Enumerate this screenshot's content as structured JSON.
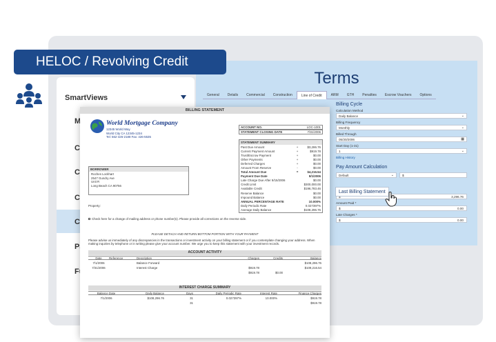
{
  "banner": {
    "title": "HELOC / Revolving Credit"
  },
  "sidebar": {
    "title": "SmartViews",
    "items": [
      {
        "label": "Ma"
      },
      {
        "label": "Ca"
      },
      {
        "label": "CA"
      },
      {
        "label": "CA"
      },
      {
        "label": "CA"
      },
      {
        "label": "Pa"
      },
      {
        "label": "Fu"
      }
    ]
  },
  "terms": {
    "title": "Terms",
    "tabs": [
      "General",
      "Details",
      "Commercial",
      "Construction",
      "Line of Credit",
      "ARM",
      "GTH",
      "Penalties",
      "Escrow Vouchers",
      "Options"
    ],
    "active_tab": "Line of Credit",
    "billing_cycle": {
      "heading": "Billing Cycle",
      "calc_method_label": "Calculation Method",
      "calc_method_value": "Daily Balance",
      "frequency_label": "Billing Frequency",
      "frequency_value": "Monthly",
      "billed_through_label": "Billed Through",
      "billed_through_value": "05/30/2006",
      "start_day_label": "Start Day (1-31)",
      "start_day_value": "1",
      "history_link": "Billing History"
    },
    "payment": {
      "heading": "Pay Amount Calculation",
      "method_value": "Default",
      "currency": "$",
      "last_statement_label": "Last Billing Statement",
      "amount_billed_label": "Amount Billed *",
      "amount_billed_value": "3,296.76",
      "amount_paid_label": "Amount Paid *",
      "amount_paid_value": "0.00",
      "late_charges_label": "Late Charges *",
      "late_charges_value": "0.00"
    }
  },
  "statement": {
    "title": "BILLING STATEMENT",
    "company": "World Mortgage Company",
    "company_addr": [
      "12345 World Way",
      "World City CA 12345-1234",
      "Tel: 562-426-2188  Fax: 426-5535"
    ],
    "account_rows": [
      {
        "k": "ACCOUNT NO.",
        "v": "LOC-1001"
      },
      {
        "k": "STATEMENT CLOSING DATE",
        "v": "7/31/2006"
      }
    ],
    "summary_title": "STATEMENT SUMMARY",
    "summary_rows": [
      {
        "k": "Past Due Amount",
        "e": "+",
        "v": "$3,286.76"
      },
      {
        "k": "Current Payment Amount",
        "e": "+",
        "v": "$919.78"
      },
      {
        "k": "Trust/Escrow Payment",
        "e": "+",
        "v": "$0.00"
      },
      {
        "k": "Other Payments",
        "e": "+",
        "v": "$0.00"
      },
      {
        "k": "Deferred Charges",
        "e": "+",
        "v": "$0.00"
      },
      {
        "k": "Amount From Reserve",
        "e": "-",
        "v": "$0.00"
      },
      {
        "k": "Total Amount Due",
        "e": "=",
        "v": "$4,216.54",
        "bold": true
      },
      {
        "k": "Payment Due Date",
        "e": "",
        "v": "8/1/2006",
        "bold": true
      },
      {
        "k": "Late Charge Due After 8/15/2006",
        "e": "",
        "v": "$0.00"
      },
      {
        "k": "Credit Limit",
        "e": "",
        "v": "$300,000.00"
      },
      {
        "k": "Available Credit",
        "e": "",
        "v": "$196,783.46"
      },
      {
        "k": "Reserve Balance",
        "e": "",
        "v": "$0.00"
      },
      {
        "k": "Impound Balance",
        "e": "",
        "v": "$0.00"
      },
      {
        "k": "ANNUAL PERCENTAGE RATE",
        "e": "",
        "v": "10.000%",
        "bold": true
      },
      {
        "k": "Daily Periodic Rate",
        "e": "",
        "v": "0.027397%"
      },
      {
        "k": "Average Daily Balance",
        "e": "",
        "v": "$108,296.76"
      }
    ],
    "borrower_title": "BORROWER",
    "borrower_lines": [
      "Roches Lockhart",
      "2547 Gundry Ave",
      "Unit R",
      "Long Beach CA 90756"
    ],
    "property_label": "Property:",
    "check_text": "Check here for a change of mailing address or phone number(s). Please provide all corrections on the reverse side.",
    "notice": "PLEASE DETACH AND RETURN BOTTOM PORTION WITH YOUR PAYMENT",
    "paragraph": "Please advise us immediately of any discrepancies in the transactions or investment activity on your billing statement or if you contemplate changing your address. When making inquiries by telephone or in writing please give your account number. We urge you to keep this statement with your investment records.",
    "activity_title": "ACCOUNT ACTIVITY",
    "activity_cols": [
      "Date",
      "Reference",
      "Description",
      "Charges",
      "Credits",
      "Balance"
    ],
    "activity_rows": [
      [
        "7/1/2006",
        "",
        "Balance Forward",
        "",
        "",
        "$108,296.76"
      ],
      [
        "7/31/2006",
        "",
        "Interest Charge",
        "$919.78",
        "",
        "$109,216.54"
      ],
      [
        "",
        "",
        "",
        "$919.78",
        "$0.00",
        ""
      ]
    ],
    "interest_title": "INTEREST CHARGE SUMMARY",
    "interest_cols": [
      "Balance Date",
      "Daily Balance",
      "Days",
      "Daily Periodic Rate",
      "Interest Rate",
      "Finance Charges"
    ],
    "interest_rows": [
      [
        "7/1/2006",
        "$108,296.76",
        "31",
        "0.027397%",
        "10.000%",
        "$919.78"
      ],
      [
        "",
        "",
        "31",
        "",
        "",
        "$919.78"
      ]
    ]
  }
}
